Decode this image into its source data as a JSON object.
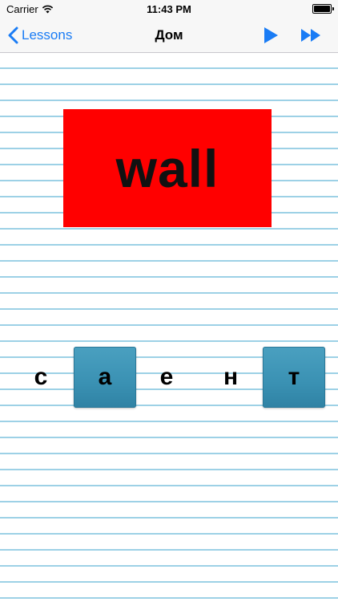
{
  "status_bar": {
    "carrier": "Carrier",
    "time": "11:43 PM",
    "wifi_icon": "wifi-icon",
    "battery_icon": "battery-icon"
  },
  "nav": {
    "back_label": "Lessons",
    "title": "Дом",
    "back_icon": "chevron-left-icon",
    "play_icon": "play-icon",
    "fast_forward_icon": "fast-forward-icon"
  },
  "card": {
    "word": "wall",
    "color": "#ff0000"
  },
  "letters": [
    {
      "char": "с",
      "tile": false
    },
    {
      "char": "а",
      "tile": true
    },
    {
      "char": "е",
      "tile": false
    },
    {
      "char": "н",
      "tile": false
    },
    {
      "char": "т",
      "tile": true
    }
  ],
  "colors": {
    "accent": "#1a7cf5",
    "tile": "#3a91b3",
    "rule_line": "#9dd1e6"
  }
}
